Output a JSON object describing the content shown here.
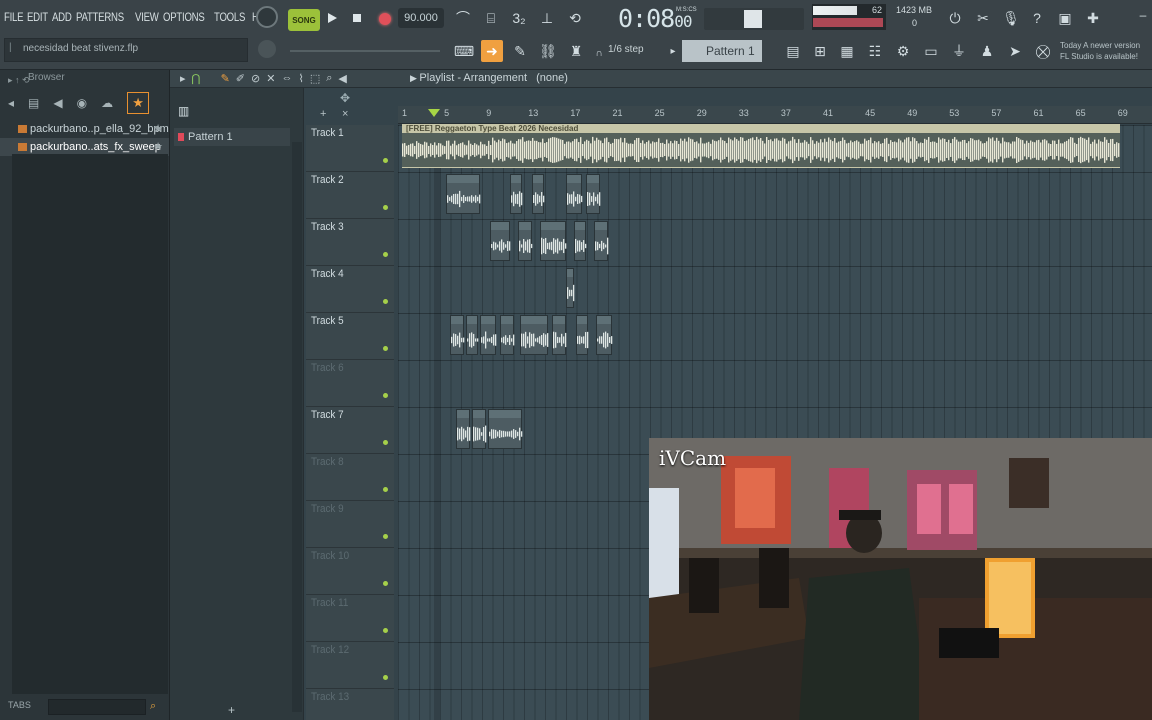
{
  "menu": [
    "FILE",
    "EDIT",
    "ADD",
    "PATTERNS",
    "VIEW",
    "OPTIONS",
    "TOOLS",
    "HELP"
  ],
  "transport": {
    "mode_label": "SONG",
    "tempo": "90.000",
    "time": "0:08",
    "time_sub": "00",
    "time_unit": "M:S:CS",
    "cpu_value": "62",
    "mem_value": "1423 MB",
    "mem_sub": "0"
  },
  "hint": "necesidad beat stivenz.flp",
  "step_label": "1/6 step",
  "pattern_selector": "Pattern 1",
  "news": [
    "Today  A newer version",
    "FL Studio is available!"
  ],
  "browser": {
    "title": "Browser",
    "items": [
      "packurbano..p_ella_92_bpm",
      "packurbano..ats_fx_sweep"
    ],
    "tabs_label": "TABS"
  },
  "playlist": {
    "title": "Playlist - Arrangement",
    "subtitle": "(none)",
    "patterns": [
      "Pattern 1"
    ],
    "ruler": [
      "1",
      "5",
      "9",
      "13",
      "17",
      "21",
      "25",
      "29",
      "33",
      "37",
      "41",
      "45",
      "49",
      "53",
      "57",
      "61",
      "65",
      "69"
    ],
    "tracks": [
      {
        "name": "Track 1",
        "active": true
      },
      {
        "name": "Track 2",
        "active": true
      },
      {
        "name": "Track 3",
        "active": true
      },
      {
        "name": "Track 4",
        "active": true
      },
      {
        "name": "Track 5",
        "active": true
      },
      {
        "name": "Track 6",
        "active": false
      },
      {
        "name": "Track 7",
        "active": true
      },
      {
        "name": "Track 8",
        "active": false
      },
      {
        "name": "Track 9",
        "active": false
      },
      {
        "name": "Track 10",
        "active": false
      },
      {
        "name": "Track 11",
        "active": false
      },
      {
        "name": "Track 12",
        "active": false
      },
      {
        "name": "Track 13",
        "active": false
      }
    ],
    "main_clip_label": "[FREE] Reggaeton Type Beat 2026 Necesidad"
  },
  "webcam": {
    "title": "iVCam"
  },
  "colors": {
    "accent": "#f0a040",
    "song_button": "#9cc13a",
    "record": "#e0505a",
    "clip": "#c7c6a8"
  }
}
